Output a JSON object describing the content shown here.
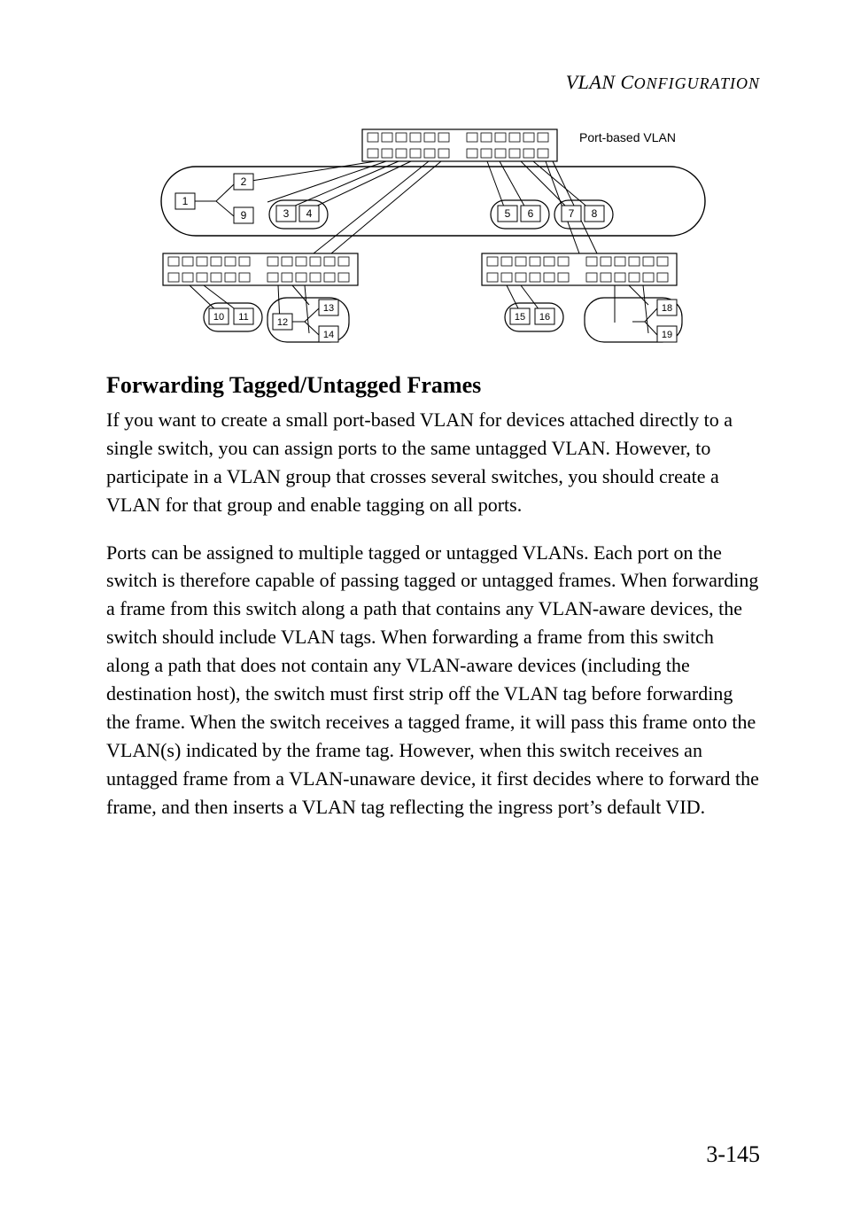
{
  "running_head": {
    "main": "VLAN C",
    "small": "ONFIGURATION"
  },
  "figure": {
    "label_portvlan": "Port-based VLAN",
    "numbers": {
      "n1": "1",
      "n2": "2",
      "n3": "3",
      "n4": "4",
      "n5": "5",
      "n6": "6",
      "n7": "7",
      "n8": "8",
      "n9": "9",
      "n10": "10",
      "n11": "11",
      "n12": "12",
      "n13": "13",
      "n14": "14",
      "n15": "15",
      "n16": "16",
      "n18": "18",
      "n19": "19"
    }
  },
  "section_title": "Forwarding Tagged/Untagged Frames",
  "para1": "If you want to create a small port-based VLAN for devices attached directly to a single switch, you can assign ports to the same untagged VLAN. However, to participate in a VLAN group that crosses several switches, you should create a VLAN for that group and enable tagging on all ports.",
  "para2": "Ports can be assigned to multiple tagged or untagged VLANs. Each port on the switch is therefore capable of passing tagged or untagged frames. When forwarding a frame from this switch along a path that contains any VLAN-aware devices, the switch should include VLAN tags. When forwarding a frame from this switch along a path that does not contain any VLAN-aware devices (including the destination host), the switch must first strip off the VLAN tag before forwarding the frame. When the switch receives a tagged frame, it will pass this frame onto the VLAN(s) indicated by the frame tag. However, when this switch receives an untagged frame from a VLAN-unaware device, it first decides where to forward the frame, and then inserts a VLAN tag reflecting the ingress port’s default VID.",
  "page_number": "3-145"
}
